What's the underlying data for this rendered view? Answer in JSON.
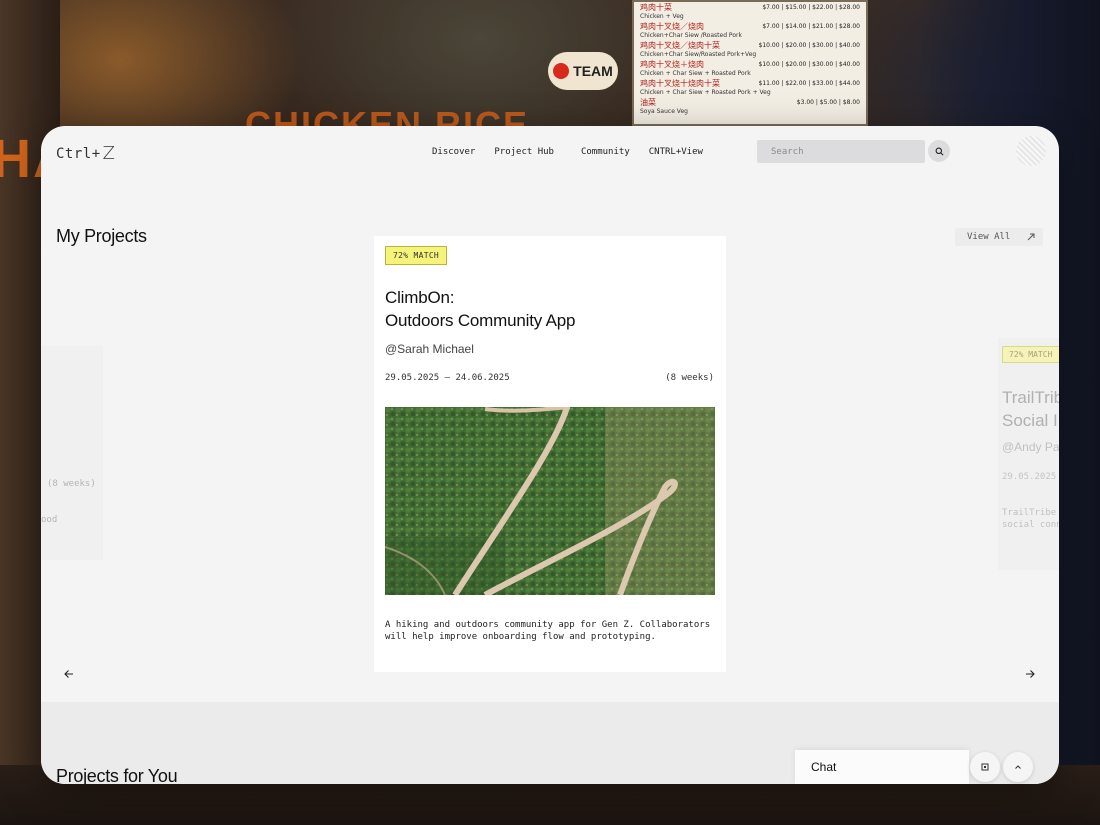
{
  "background": {
    "banner_text": "HAI",
    "banner_text2": "CHICKEN RICE",
    "badge_text": "TEAM",
    "menu": [
      {
        "zh": "鸡肉十菜",
        "en": "Chicken + Veg",
        "prices": "$7.00 | $15.00 | $22.00 | $28.00"
      },
      {
        "zh": "鸡肉十叉烧／烧肉",
        "en": "Chicken+Char Siew /Roasted Pork",
        "prices": "$7.00 | $14.00 | $21.00 | $28.00"
      },
      {
        "zh": "鸡肉十叉烧／烧肉十菜",
        "en": "Chicken+Char Siew/Roasted Pork+Veg",
        "prices": "$10.00 | $20.00 | $30.00 | $40.00"
      },
      {
        "zh": "鸡肉十叉烧＋烧肉",
        "en": "Chicken + Char Siew + Roasted Pork",
        "prices": "$10.00 | $20.00 | $30.00 | $40.00"
      },
      {
        "zh": "鸡肉十叉烧十烧肉十菜",
        "en": "Chicken + Char Siew + Roasted Pork + Veg",
        "prices": "$11.00 | $22.00 | $33.00 | $44.00"
      },
      {
        "zh": "油菜",
        "en": "Soya Sauce Veg",
        "prices": "$3.00 | $5.00 | $8.00"
      }
    ]
  },
  "nav": {
    "brand_prefix": "Ctrl+",
    "brand_suffix": "Z",
    "links": [
      "Discover",
      "Project Hub",
      "Community",
      "CNTRL+View"
    ],
    "search_placeholder": "Search"
  },
  "my_projects": {
    "title": "My Projects",
    "view_all": "View All",
    "left_card": {
      "duration": "(8 weeks)",
      "fragment": "ood"
    },
    "main_card": {
      "match": "72% MATCH",
      "title_line1": "ClimbOn:",
      "title_line2": "Outdoors Community App",
      "author": "@Sarah Michael",
      "dates": "29.05.2025 – 24.06.2025",
      "duration": "(8 weeks)",
      "description": "A hiking and outdoors community app for Gen Z. Collaborators will help improve onboarding flow and prototyping."
    },
    "right_card": {
      "match": "72% MATCH",
      "title_line1": "TrailTrib",
      "title_line2": "Social I",
      "author": "@Andy Pa",
      "dates": "29.05.2025",
      "desc_line1": "TrailTribe",
      "desc_line2": "social conn"
    },
    "prev_icon": "arrow-left-icon",
    "next_icon": "arrow-right-icon"
  },
  "projects_for_you": {
    "title": "Projects for You"
  },
  "chat": {
    "label": "Chat"
  },
  "colors": {
    "match_badge": "#f6f37a",
    "window_bg": "#f4f4f5",
    "search_bg": "#dcdcde"
  }
}
